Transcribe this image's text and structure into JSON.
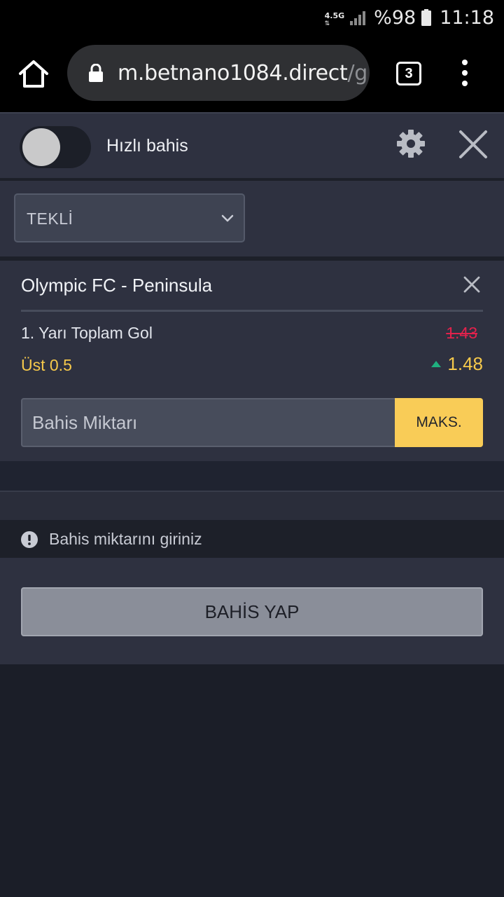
{
  "status_bar": {
    "network": "4.5G",
    "battery": "%98",
    "time": "11:18"
  },
  "browser": {
    "url_host": "m.betnano1084.direct",
    "url_rest": "/g",
    "tab_count": "3"
  },
  "quick_bet": {
    "label": "Hızlı bahis",
    "enabled": false
  },
  "bet_type": {
    "selected": "TEKLİ"
  },
  "bet": {
    "match": "Olympic FC - Peninsula",
    "market": "1. Yarı Toplam Gol",
    "old_odds": "1.43",
    "selection": "Üst 0.5",
    "odds": "1.48",
    "stake_placeholder": "Bahis Miktarı",
    "max_label": "MAKS."
  },
  "warning": {
    "text": "Bahis miktarını giriniz"
  },
  "submit": {
    "label": "BAHİS YAP"
  },
  "colors": {
    "accent": "#f9cc57",
    "odds_up": "#1fb07f",
    "odds_old": "#e2224c"
  }
}
